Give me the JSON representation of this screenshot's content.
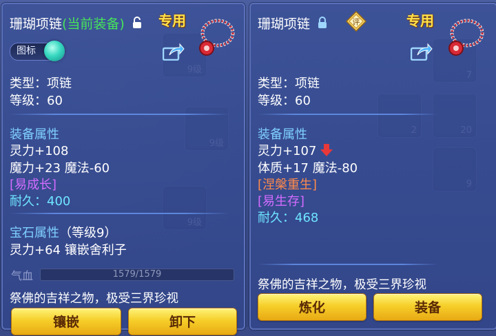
{
  "left": {
    "item_name": "珊瑚项链",
    "equipped_tag": "(当前装备)",
    "exclusive": "专用",
    "icon_toggle_label": "图标",
    "type_line": "类型：项链",
    "level_line": "等级：60",
    "equip_attr_heading": "装备属性",
    "attr1": "灵力+108",
    "attr2": "魔力+23 魔法-60",
    "special1": "[易成长]",
    "durability_label": "耐久：",
    "durability_value": "400",
    "gem_heading": "宝石属性",
    "gem_level": "（等级9）",
    "gem_attr": "灵力+64 镶嵌舍利子",
    "hp_label": "气血",
    "hp_value": "1579/1579",
    "description": "祭佛的吉祥之物，极受三界珍视",
    "btn_inlay": "镶嵌",
    "btn_unequip": "卸下"
  },
  "right": {
    "item_name": "珊瑚项链",
    "rate_badge": "评",
    "exclusive": "专用",
    "type_line": "类型：项链",
    "level_line": "等级：60",
    "equip_attr_heading": "装备属性",
    "attr1": "灵力+107",
    "attr2": "体质+17 魔法-80",
    "special1": "[涅槃重生]",
    "special2": "[易生存]",
    "durability_label": "耐久：",
    "durability_value": "468",
    "description": "祭佛的吉祥之物，极受三界珍视",
    "btn_refine": "炼化",
    "btn_equip": "装备"
  },
  "background_slot_levels": [
    "9级",
    "9级",
    "9级",
    "7",
    "2",
    "20",
    "9"
  ],
  "colors": {
    "equipped_green": "#46e45a",
    "exclusive_gold": "#ffe24a",
    "heading_blue": "#7fd0ff",
    "special_purple": "#d36cff",
    "special_orange": "#ff8a4a",
    "durability_cyan": "#6fe6ff",
    "button_gold": "#f6cf2a"
  },
  "icons": [
    "lock-open-icon",
    "lock-closed-icon",
    "share-icon",
    "necklace-icon",
    "rate-badge-icon",
    "down-arrow-icon",
    "toggle-knob-icon"
  ]
}
